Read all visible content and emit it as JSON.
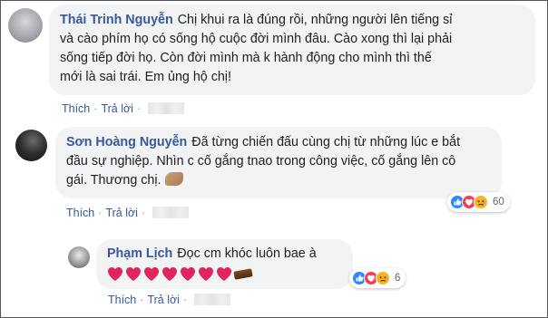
{
  "comments": [
    {
      "author": "Thái Trinh Nguyễn",
      "lines": [
        "Chị khui ra là đúng rồi, những người lên tiếng sỉ",
        "và cào phím họ có sống hộ cuộc đời mình đâu. Cào xong thì lại phải",
        "sống tiếp đời họ. Còn đời mình mà k hành động cho mình thì thế",
        "mới là sai trái. Em ủng hộ chị!"
      ],
      "actions": {
        "like": "Thích",
        "reply": "Trả lời"
      }
    },
    {
      "author": "Sơn Hoàng Nguyễn",
      "lines": [
        "Đã từng chiến đấu cùng chị từ những lúc e bắt",
        "đầu sự nghiệp. Nhìn c cố gắng tnao trong công việc, cố gắng lên cô",
        "gái. Thương chị."
      ],
      "actions": {
        "like": "Thích",
        "reply": "Trả lời"
      },
      "reaction_count": "60",
      "reaction_icons": [
        "like-icon",
        "love-icon",
        "sad-icon"
      ]
    },
    {
      "author": "Phạm Lịch",
      "lines": [
        "Đọc cm khóc luôn bae à"
      ],
      "hearts": 7,
      "actions": {
        "like": "Thích",
        "reply": "Trả lời"
      },
      "reaction_count": "6",
      "reaction_icons": [
        "like-icon",
        "love-icon",
        "sad-icon"
      ]
    }
  ],
  "colors": {
    "author": "#385898",
    "bubble": "#f2f3f5",
    "heart": "#e0245e",
    "like": "#2d88ff",
    "love": "#f33e58",
    "sad": "#f7b125"
  }
}
